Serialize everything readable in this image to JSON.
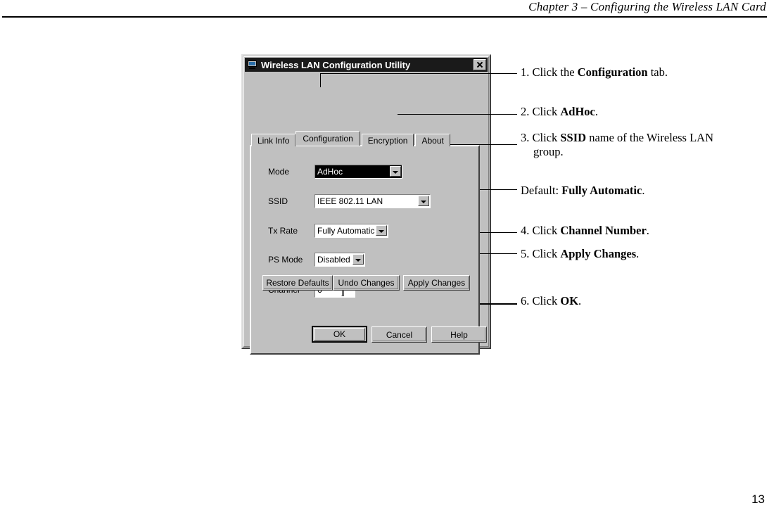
{
  "page": {
    "header_title": "Chapter 3 – Configuring the Wireless LAN Card",
    "page_number": "13"
  },
  "dialog": {
    "title": "Wireless LAN Configuration Utility",
    "icon": "computer-icon",
    "close_label": "×",
    "tabs": [
      {
        "label": "Link Info",
        "active": false
      },
      {
        "label": "Configuration",
        "active": true
      },
      {
        "label": "Encryption",
        "active": false
      },
      {
        "label": "About",
        "active": false
      }
    ],
    "fields": [
      {
        "label": "Mode",
        "value": "AdHoc",
        "control": "combobox",
        "selected": true
      },
      {
        "label": "SSID",
        "value": "IEEE 802.11 LAN",
        "control": "combobox",
        "selected": false
      },
      {
        "label": "Tx Rate",
        "value": "Fully Automatic",
        "control": "combobox",
        "selected": false
      },
      {
        "label": "PS Mode",
        "value": "Disabled",
        "control": "combobox",
        "selected": false
      },
      {
        "label": "Channel",
        "value": "6",
        "control": "spinner",
        "selected": false
      }
    ],
    "action_buttons": [
      {
        "label": "Restore Defaults"
      },
      {
        "label": "Undo Changes"
      },
      {
        "label": "Apply Changes"
      }
    ],
    "dialog_buttons": [
      {
        "label": "OK",
        "default": true
      },
      {
        "label": "Cancel",
        "default": false
      },
      {
        "label": "Help",
        "default": false
      }
    ]
  },
  "annotations": [
    {
      "id": "step1",
      "prefix": "1. Click the ",
      "bold": "Configuration",
      "suffix": " tab.",
      "second_line": ""
    },
    {
      "id": "step2",
      "prefix": "2. Click ",
      "bold": "AdHoc",
      "suffix": ".",
      "second_line": ""
    },
    {
      "id": "step3",
      "prefix": "3. Click ",
      "bold": "SSID",
      "suffix": " name of the Wireless LAN",
      "second_line": "group."
    },
    {
      "id": "default",
      "prefix": "Default: ",
      "bold": "Fully Automatic",
      "suffix": ".",
      "second_line": ""
    },
    {
      "id": "step4",
      "prefix": "4. Click ",
      "bold": "Channel Number",
      "suffix": ".",
      "second_line": ""
    },
    {
      "id": "step5",
      "prefix": "5. Click ",
      "bold": "Apply Changes",
      "suffix": ".",
      "second_line": ""
    },
    {
      "id": "step6",
      "prefix": "6. Click ",
      "bold": "OK",
      "suffix": ".",
      "second_line": ""
    }
  ],
  "colors": {
    "dialog_face": "#c0c0c0",
    "titlebar": "#1a1a1a",
    "titlebar_text": "#ffffff",
    "field_bg": "#ffffff",
    "selection_bg": "#000000",
    "selection_text": "#ffffff",
    "ink": "#000000",
    "paper": "#ffffff"
  }
}
